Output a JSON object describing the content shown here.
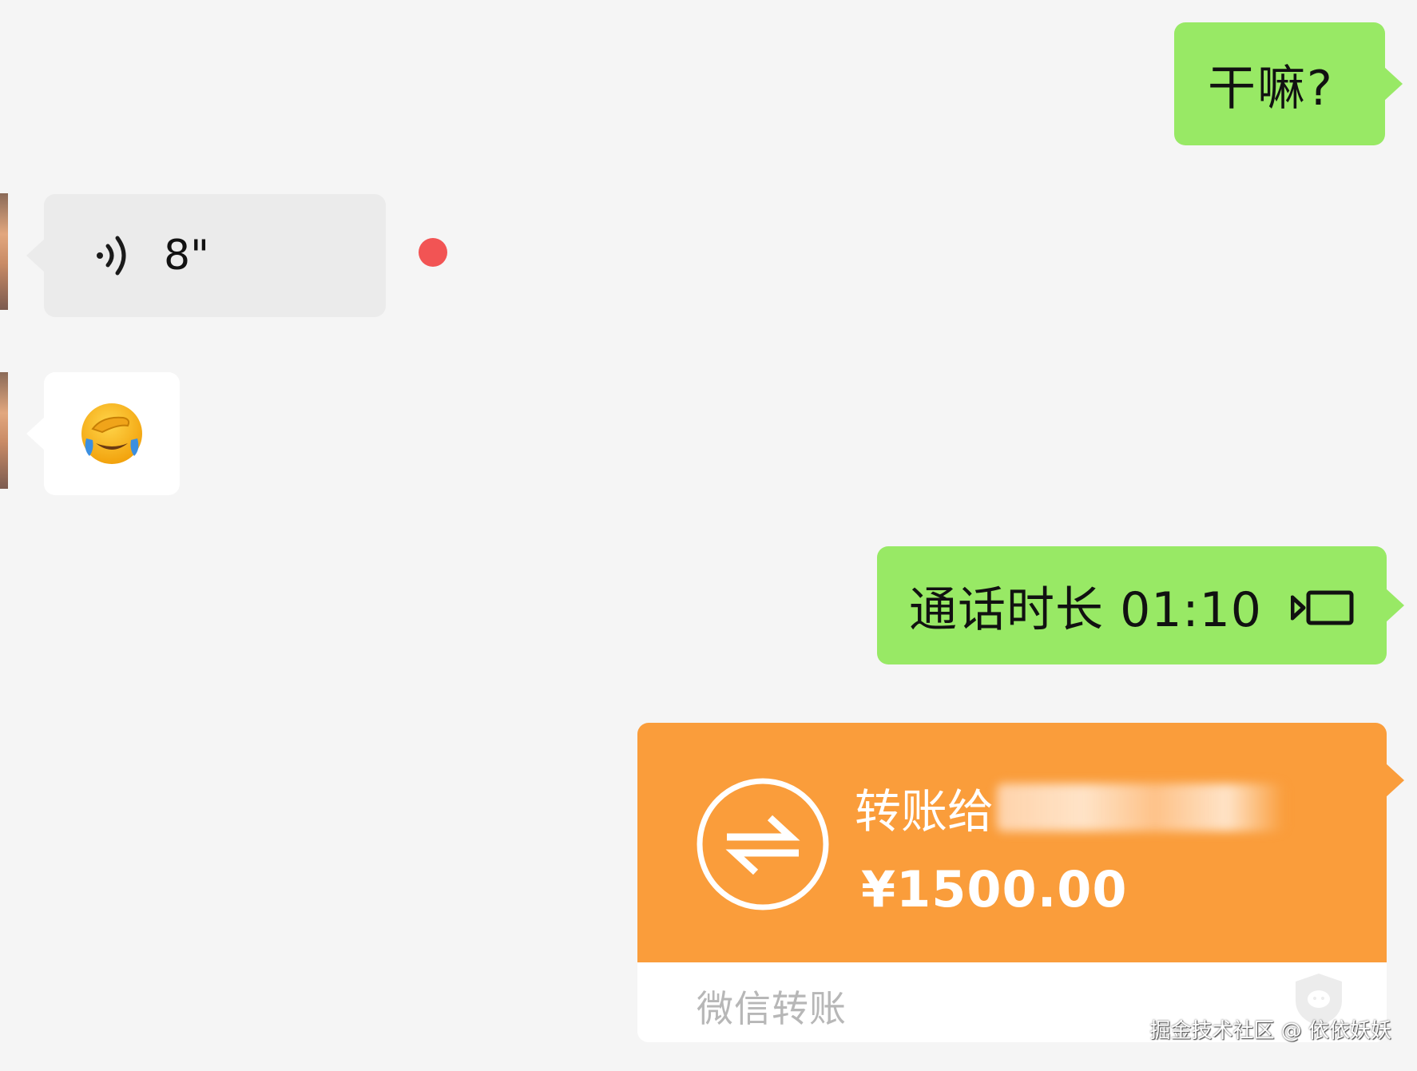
{
  "messages": {
    "greeting": {
      "text": "干嘛?"
    },
    "voice": {
      "duration": "8\""
    },
    "emoji": {
      "icon": "face-palm-crying-emoji"
    },
    "call": {
      "text": "通话时长 01:10"
    },
    "transfer": {
      "recipient_prefix": "转账给",
      "amount": "¥1500.00",
      "footer": "微信转账"
    }
  },
  "watermark": "掘金技术社区 @ 依依妖妖",
  "colors": {
    "background": "#f5f5f5",
    "outgoing_bubble": "#98e965",
    "incoming_voice_bubble": "#ebebeb",
    "incoming_bubble": "#ffffff",
    "unread_dot": "#f25454",
    "transfer_card": "#fa9d3b"
  }
}
